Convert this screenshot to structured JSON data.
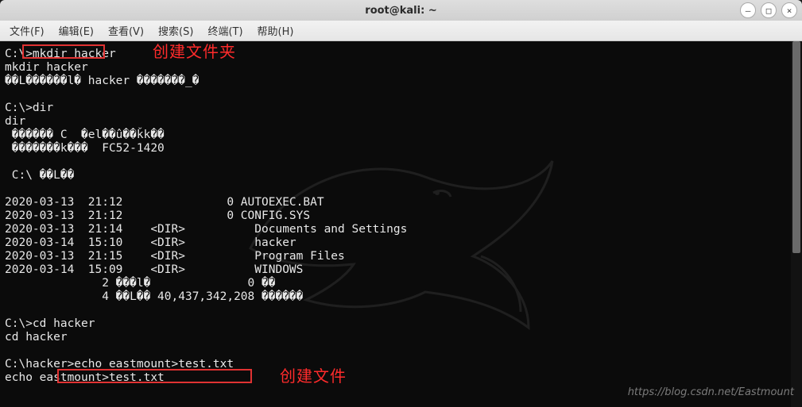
{
  "window": {
    "title": "root@kali: ~",
    "controls": {
      "min": "—",
      "max": "□",
      "close": "×"
    }
  },
  "menubar": {
    "file": "文件(F)",
    "edit": "编辑(E)",
    "view": "查看(V)",
    "search": "搜索(S)",
    "terminal": "终端(T)",
    "help": "帮助(H)"
  },
  "annotations": {
    "mkdir": "创建文件夹",
    "echo": "创建文件"
  },
  "watermark": "https://blog.csdn.net/Eastmount",
  "terminal_lines": [
    "C:\\>mkdir hacker",
    "mkdir hacker",
    "��L������l� hacker �������_�",
    "",
    "C:\\>dir",
    "dir",
    " ������ C  �el��û��ǩk��",
    " �������k���  FC52-1420",
    "",
    " C:\\ ��L��",
    "",
    "2020-03-13  21:12               0 AUTOEXEC.BAT",
    "2020-03-13  21:12               0 CONFIG.SYS",
    "2020-03-13  21:14    <DIR>          Documents and Settings",
    "2020-03-14  15:10    <DIR>          hacker",
    "2020-03-13  21:15    <DIR>          Program Files",
    "2020-03-14  15:09    <DIR>          WINDOWS",
    "              2 ���l�              0 ��",
    "              4 ��L�� 40,437,342,208 ������",
    "",
    "C:\\>cd hacker",
    "cd hacker",
    "",
    "C:\\hacker>echo eastmount>test.txt",
    "echo eastmount>test.txt"
  ]
}
